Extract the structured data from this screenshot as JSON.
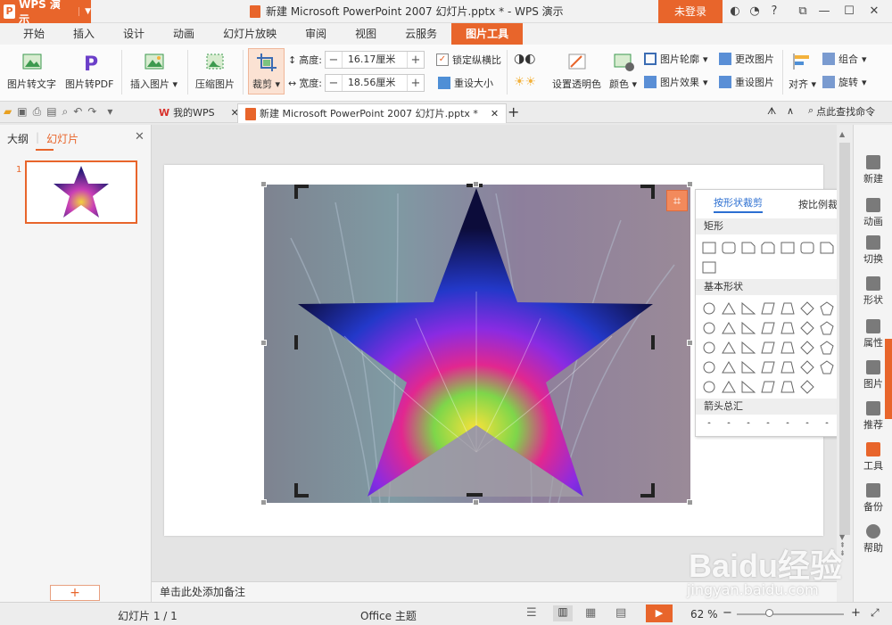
{
  "app": {
    "name": "WPS 演示",
    "login": "未登录"
  },
  "window_title": "新建 Microsoft PowerPoint 2007 幻灯片.pptx * - WPS 演示",
  "ribbon_tabs": [
    "开始",
    "插入",
    "设计",
    "动画",
    "幻灯片放映",
    "审阅",
    "视图",
    "云服务",
    "图片工具"
  ],
  "active_tab": "图片工具",
  "ribbon": {
    "pic_to_text": "图片转文字",
    "pic_to_pdf": "图片转PDF",
    "insert_picture": "插入图片",
    "compress": "压缩图片",
    "crop": "裁剪",
    "height_label": "高度:",
    "height_value": "16.17厘米",
    "width_label": "宽度:",
    "width_value": "18.56厘米",
    "lock_ratio": "锁定纵横比",
    "reset_size": "重设大小",
    "set_transparent": "设置透明色",
    "color": "颜色",
    "pic_outline": "图片轮廓",
    "pic_effect": "图片效果",
    "change_pic": "更改图片",
    "reset_pic": "重设图片",
    "align": "对齐",
    "group": "组合",
    "rotate": "旋转"
  },
  "doc_tabs": {
    "mywps": "我的WPS",
    "current": "新建 Microsoft PowerPoint 2007 幻灯片.pptx *",
    "search": "点此查找命令"
  },
  "left_panel": {
    "tab_outline": "大纲",
    "tab_slides": "幻灯片",
    "slide_number": "1"
  },
  "right_sidebar": [
    "新建",
    "动画",
    "切换",
    "形状",
    "属性",
    "图片",
    "推荐",
    "工具",
    "备份",
    "帮助"
  ],
  "crop_dropdown": {
    "tab_shape": "按形状裁剪",
    "tab_ratio": "按比例裁剪",
    "sec_rect": "矩形",
    "sec_basic": "基本形状",
    "sec_arrows": "箭头总汇"
  },
  "notes_placeholder": "单击此处添加备注",
  "status": {
    "slide": "幻灯片 1 / 1",
    "theme": "Office 主题",
    "zoom": "62 %"
  },
  "colors": {
    "accent": "#e8652b"
  },
  "watermark": {
    "brand": "Baidu经验",
    "url": "jingyan.baidu.com"
  }
}
